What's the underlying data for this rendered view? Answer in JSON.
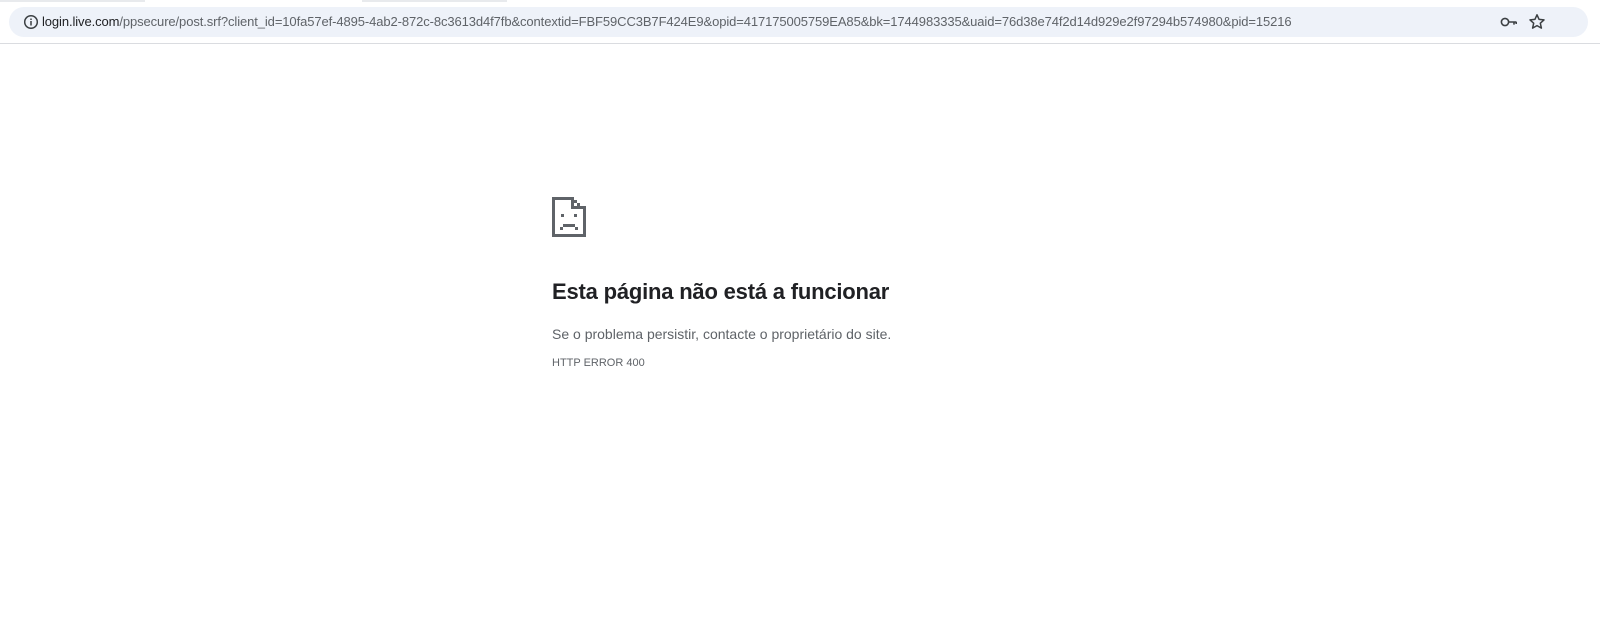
{
  "browser": {
    "url_host": "login.live.com",
    "url_rest": "/ppsecure/post.srf?client_id=10fa57ef-4895-4ab2-872c-8c3613d4f7fb&contextid=FBF59CC3B7F424E9&opid=417175005759EA85&bk=1744983335&uaid=76d38e74f2d14d929e2f97294b574980&pid=15216",
    "icons": {
      "site_info": "info-icon",
      "passwords": "key-icon",
      "bookmark": "star-icon"
    }
  },
  "error_page": {
    "icon": "sad-page-icon",
    "title": "Esta página não está a funcionar",
    "message": "Se o problema persistir, contacte o proprietário do site.",
    "error_code": "HTTP ERROR 400"
  },
  "colors": {
    "omnibox_bg": "#eef2f9",
    "title_text": "#202124",
    "secondary_text": "#5f6368"
  }
}
